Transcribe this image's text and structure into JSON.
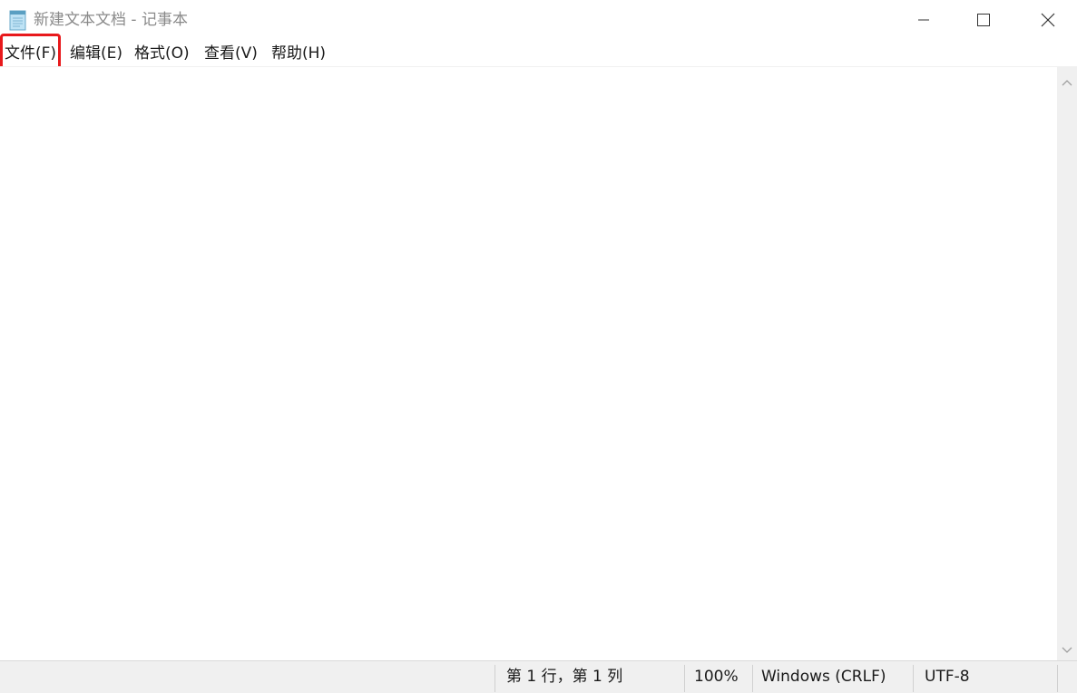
{
  "window": {
    "title": "新建文本文档 - 记事本",
    "app_icon": "notepad-icon",
    "controls": {
      "minimize_icon": "minimize-icon",
      "maximize_icon": "maximize-icon",
      "close_icon": "close-icon"
    }
  },
  "menu": {
    "items": [
      {
        "label": "文件(F)",
        "highlighted": true
      },
      {
        "label": "编辑(E)"
      },
      {
        "label": "格式(O)"
      },
      {
        "label": "查看(V)"
      },
      {
        "label": "帮助(H)"
      }
    ],
    "highlight_color": "#e8191c"
  },
  "editor": {
    "content": ""
  },
  "statusbar": {
    "position": "第 1 行，第 1 列",
    "zoom": "100%",
    "line_ending": "Windows (CRLF)",
    "encoding": "UTF-8"
  }
}
